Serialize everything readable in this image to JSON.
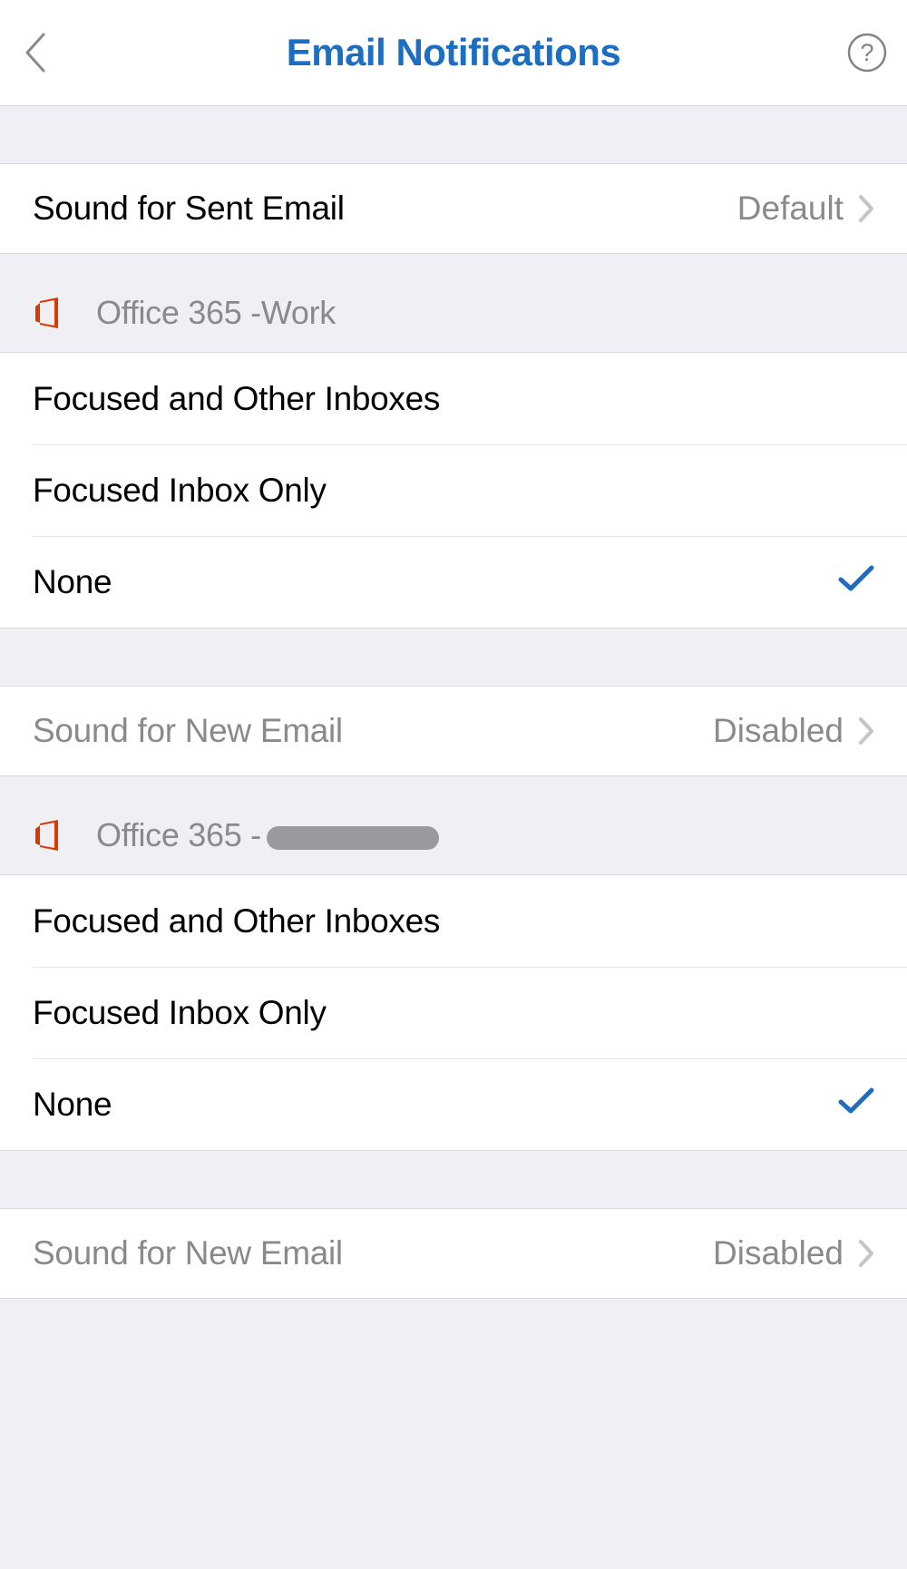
{
  "header": {
    "title": "Email Notifications"
  },
  "sent_sound": {
    "label": "Sound for Sent Email",
    "value": "Default"
  },
  "accounts": [
    {
      "name_prefix": "Office 365 - ",
      "name_suffix": "Work",
      "redacted": false,
      "options": {
        "both": "Focused and Other Inboxes",
        "focused": "Focused Inbox Only",
        "none": "None"
      },
      "selected": "none",
      "new_sound": {
        "label": "Sound for New Email",
        "value": "Disabled"
      },
      "disabled": true
    },
    {
      "name_prefix": "Office 365 - ",
      "name_suffix": "",
      "redacted": true,
      "options": {
        "both": "Focused and Other Inboxes",
        "focused": "Focused Inbox Only",
        "none": "None"
      },
      "selected": "none",
      "new_sound": {
        "label": "Sound for New Email",
        "value": "Disabled"
      },
      "disabled": true
    }
  ]
}
